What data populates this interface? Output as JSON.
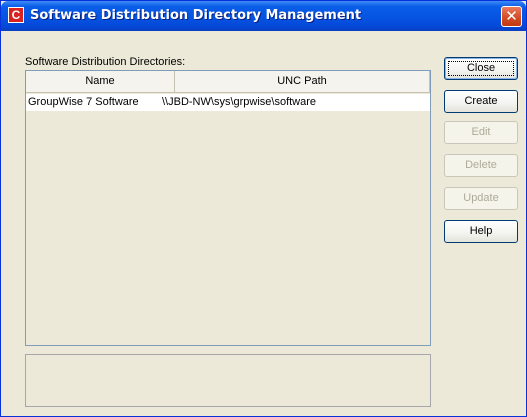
{
  "window": {
    "title": "Software Distribution Directory Management",
    "icon_letter": "C",
    "close_glyph": "✕"
  },
  "list": {
    "caption": "Software Distribution Directories:",
    "columns": [
      "Name",
      "UNC Path"
    ],
    "rows": [
      {
        "name": "GroupWise 7 Software",
        "unc": "\\\\JBD-NW\\sys\\grpwise\\software"
      }
    ]
  },
  "buttons": {
    "close": "Close",
    "create": "Create",
    "edit": "Edit",
    "delete": "Delete",
    "update": "Update",
    "help": "Help"
  },
  "colors": {
    "titlebar": "#0654e2",
    "dialog_bg": "#ece9d8",
    "close_button": "#d24a24"
  }
}
